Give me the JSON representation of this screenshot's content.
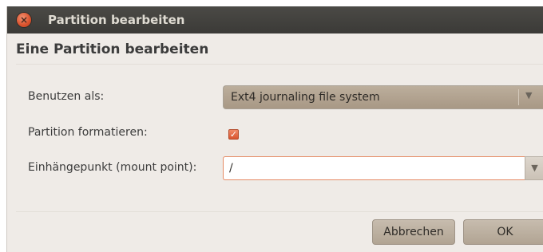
{
  "window": {
    "title": "Partition bearbeiten",
    "close_icon": "close-icon"
  },
  "dialog": {
    "heading": "Eine Partition bearbeiten",
    "use_as": {
      "label": "Benutzen als:",
      "value": "Ext4 journaling file system",
      "arrow_icon": "chevron-down-icon"
    },
    "format": {
      "label": "Partition formatieren:",
      "checked": true,
      "check_glyph": "✓"
    },
    "mount_point": {
      "label": "Einhängepunkt (mount point):",
      "value": "/",
      "arrow_icon": "chevron-down-icon"
    }
  },
  "buttons": {
    "cancel": "Abbrechen",
    "ok": "OK"
  },
  "colors": {
    "accent": "#e0663c",
    "titlebar": "#3f3e3a",
    "background": "#efebe7"
  }
}
